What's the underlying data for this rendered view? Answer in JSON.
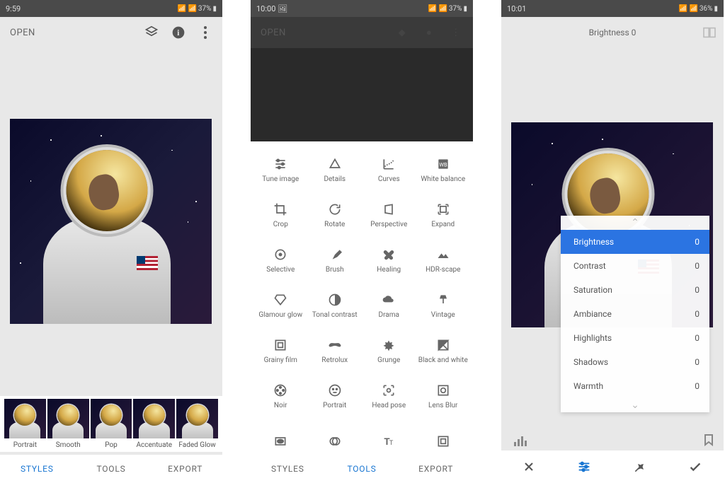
{
  "panel1": {
    "status": {
      "time": "9:59",
      "battery": "37%"
    },
    "open_label": "OPEN",
    "styles": [
      {
        "label": "Portrait"
      },
      {
        "label": "Smooth"
      },
      {
        "label": "Pop"
      },
      {
        "label": "Accentuate"
      },
      {
        "label": "Faded Glow"
      }
    ],
    "tabs": {
      "styles": "STYLES",
      "tools": "TOOLS",
      "export": "EXPORT"
    }
  },
  "panel2": {
    "status": {
      "time": "10:00",
      "battery": "37%"
    },
    "open_label": "OPEN",
    "tools": [
      {
        "label": "Tune image"
      },
      {
        "label": "Details"
      },
      {
        "label": "Curves"
      },
      {
        "label": "White balance"
      },
      {
        "label": "Crop"
      },
      {
        "label": "Rotate"
      },
      {
        "label": "Perspective"
      },
      {
        "label": "Expand"
      },
      {
        "label": "Selective"
      },
      {
        "label": "Brush"
      },
      {
        "label": "Healing"
      },
      {
        "label": "HDR-scape"
      },
      {
        "label": "Glamour glow"
      },
      {
        "label": "Tonal contrast"
      },
      {
        "label": "Drama"
      },
      {
        "label": "Vintage"
      },
      {
        "label": "Grainy film"
      },
      {
        "label": "Retrolux"
      },
      {
        "label": "Grunge"
      },
      {
        "label": "Black and white"
      },
      {
        "label": "Noir"
      },
      {
        "label": "Portrait"
      },
      {
        "label": "Head pose"
      },
      {
        "label": "Lens Blur"
      }
    ],
    "partial_row": true,
    "tabs": {
      "styles": "STYLES",
      "tools": "TOOLS",
      "export": "EXPORT"
    }
  },
  "panel3": {
    "status": {
      "time": "10:01",
      "battery": "36%"
    },
    "header_label": "Brightness 0",
    "params": [
      {
        "name": "Brightness",
        "value": "0",
        "active": true
      },
      {
        "name": "Contrast",
        "value": "0"
      },
      {
        "name": "Saturation",
        "value": "0"
      },
      {
        "name": "Ambiance",
        "value": "0"
      },
      {
        "name": "Highlights",
        "value": "0"
      },
      {
        "name": "Shadows",
        "value": "0"
      },
      {
        "name": "Warmth",
        "value": "0"
      }
    ]
  }
}
